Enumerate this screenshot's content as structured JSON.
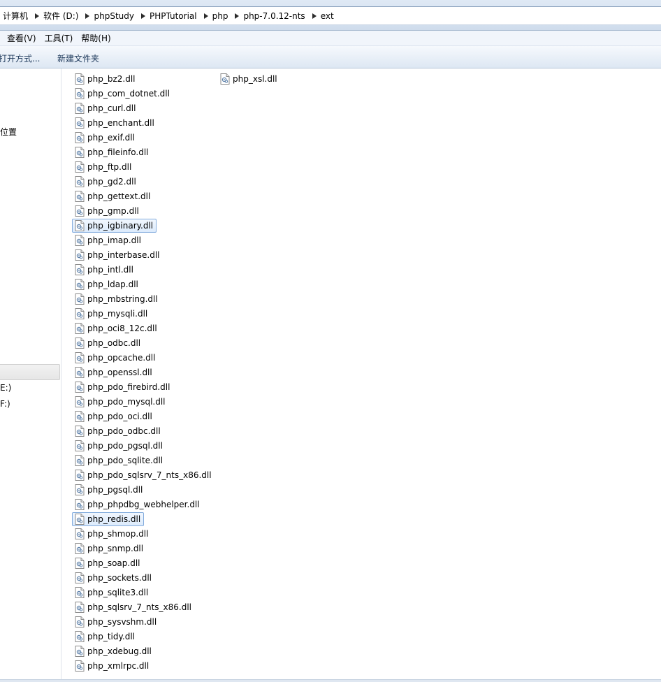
{
  "address_bar": {
    "crumbs": [
      "计算机",
      "软件 (D:)",
      "phpStudy",
      "PHPTutorial",
      "php",
      "php-7.0.12-nts",
      "ext"
    ]
  },
  "menu": [
    "查看(V)",
    "工具(T)",
    "帮助(H)"
  ],
  "commands": {
    "open_with": "打开方式...",
    "new_folder": "新建文件夹"
  },
  "nav": {
    "location_label": "位置",
    "drive_e": "E:)",
    "drive_f": "F:)"
  },
  "files": [
    "php_bz2.dll",
    "php_com_dotnet.dll",
    "php_curl.dll",
    "php_enchant.dll",
    "php_exif.dll",
    "php_fileinfo.dll",
    "php_ftp.dll",
    "php_gd2.dll",
    "php_gettext.dll",
    "php_gmp.dll",
    "php_igbinary.dll",
    "php_imap.dll",
    "php_interbase.dll",
    "php_intl.dll",
    "php_ldap.dll",
    "php_mbstring.dll",
    "php_mysqli.dll",
    "php_oci8_12c.dll",
    "php_odbc.dll",
    "php_opcache.dll",
    "php_openssl.dll",
    "php_pdo_firebird.dll",
    "php_pdo_mysql.dll",
    "php_pdo_oci.dll",
    "php_pdo_odbc.dll",
    "php_pdo_pgsql.dll",
    "php_pdo_sqlite.dll",
    "php_pdo_sqlsrv_7_nts_x86.dll",
    "php_pgsql.dll",
    "php_phpdbg_webhelper.dll",
    "php_redis.dll",
    "php_shmop.dll",
    "php_snmp.dll",
    "php_soap.dll",
    "php_sockets.dll",
    "php_sqlite3.dll",
    "php_sqlsrv_7_nts_x86.dll",
    "php_sysvshm.dll",
    "php_tidy.dll",
    "php_xdebug.dll",
    "php_xmlrpc.dll",
    "php_xsl.dll"
  ],
  "highlighted_files": [
    "php_igbinary.dll",
    "php_redis.dll"
  ]
}
